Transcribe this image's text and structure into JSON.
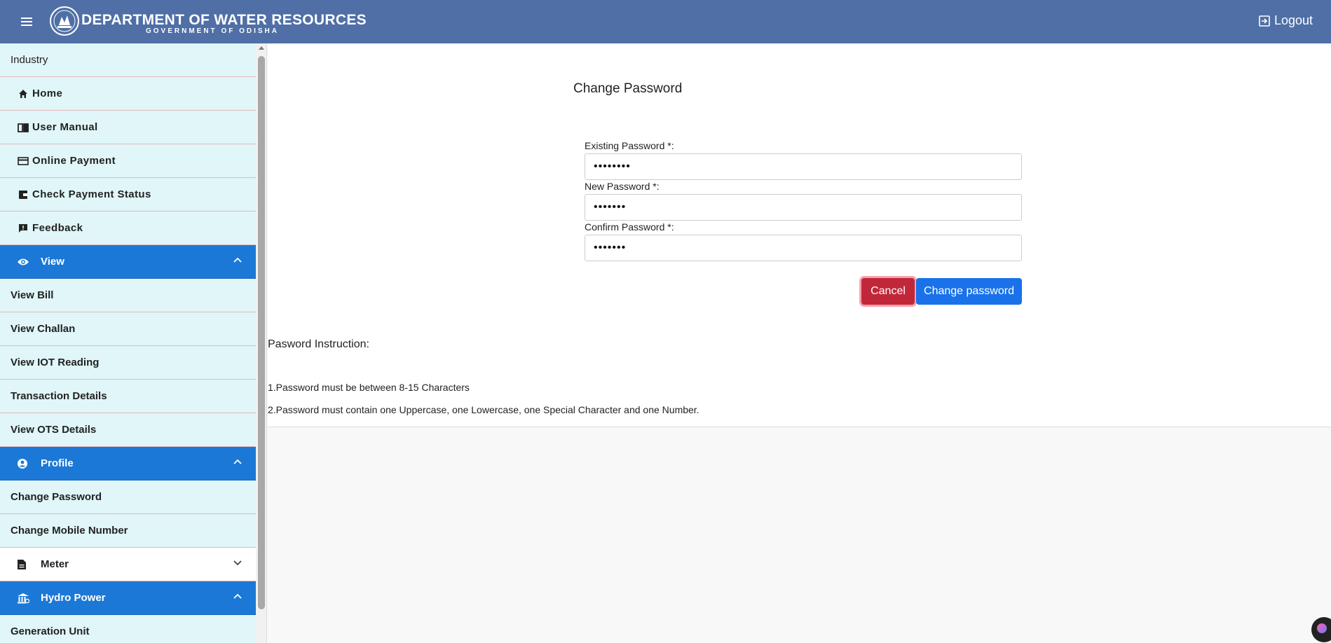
{
  "header": {
    "title": "DEPARTMENT OF WATER RESOURCES",
    "subtitle": "GOVERNMENT OF ODISHA",
    "logout_label": "Logout",
    "bg_color": "#4f6fa6"
  },
  "sidebar": {
    "top_label": "Industry",
    "items": [
      {
        "label": "Home",
        "icon": "home-icon"
      },
      {
        "label": "User Manual",
        "icon": "book-icon"
      },
      {
        "label": "Online Payment",
        "icon": "credit-card-icon"
      },
      {
        "label": "Check Payment Status",
        "icon": "wallet-icon"
      },
      {
        "label": "Feedback",
        "icon": "feedback-icon"
      }
    ],
    "view_group": {
      "label": "View",
      "icon": "eye-icon",
      "expanded": true
    },
    "view_items": [
      "View Bill",
      "View Challan",
      "View IOT Reading",
      "Transaction Details",
      "View OTS Details"
    ],
    "profile_group": {
      "label": "Profile",
      "icon": "user-circle-icon",
      "expanded": true
    },
    "profile_items": [
      "Change Password",
      "Change Mobile Number"
    ],
    "meter_group": {
      "label": "Meter",
      "icon": "document-icon",
      "expanded": false
    },
    "hydro_group": {
      "label": "Hydro Power",
      "icon": "bank-icon",
      "expanded": true
    },
    "hydro_items": [
      "Generation Unit"
    ],
    "group_color": "#1c78d6",
    "item_bg": "#e0f6f8"
  },
  "form": {
    "title": "Change Password",
    "existing_label": "Existing Password *:",
    "existing_value": "••••••••",
    "new_label": "New Password *:",
    "new_value": "•••••••",
    "confirm_label": "Confirm Password *:",
    "confirm_value": "•••••••",
    "cancel_label": "Cancel",
    "submit_label": "Change password",
    "cancel_color": "#c0283a",
    "submit_color": "#1a72ea"
  },
  "instructions": {
    "title": "Pasword Instruction:",
    "lines": [
      "1.Password must be between 8-15 Characters",
      "2.Password must contain one Uppercase, one Lowercase, one Special Character and one Number."
    ]
  }
}
